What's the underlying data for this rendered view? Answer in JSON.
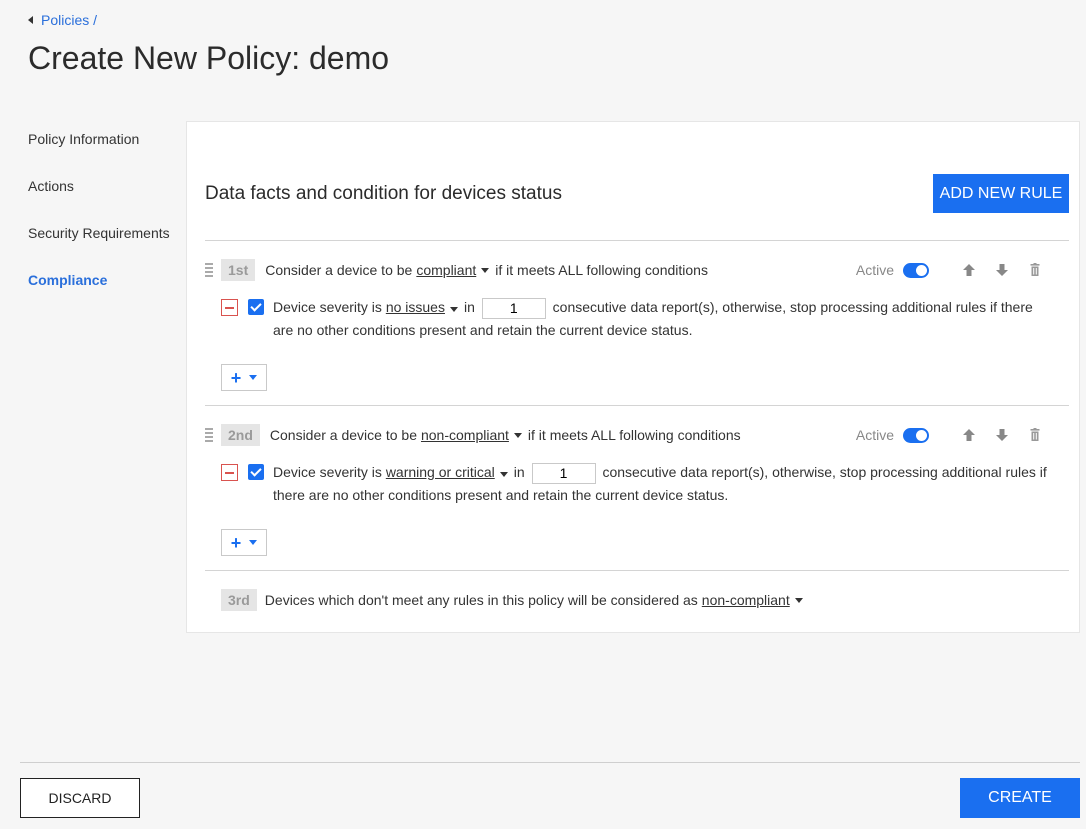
{
  "breadcrumb": {
    "label": "Policies /"
  },
  "page_title": "Create New Policy: demo",
  "sidebar": {
    "items": [
      {
        "label": "Policy Information",
        "active": false
      },
      {
        "label": "Actions",
        "active": false
      },
      {
        "label": "Security Requirements",
        "active": false
      },
      {
        "label": "Compliance",
        "active": true
      }
    ]
  },
  "panel": {
    "title": "Data facts and condition for devices status",
    "add_rule_label": "ADD NEW RULE",
    "rules": [
      {
        "rank": "1st",
        "prefix": "Consider a device to be",
        "status": "compliant",
        "suffix": "if it meets ALL following conditions",
        "active_label": "Active",
        "active": true,
        "condition": {
          "prefix": "Device severity is",
          "severity": "no issues",
          "in_label": "in",
          "count": "1",
          "rest": "consecutive data report(s), otherwise, stop processing additional rules if there are no other conditions present and retain the current device status."
        }
      },
      {
        "rank": "2nd",
        "prefix": "Consider a device to be",
        "status": "non-compliant",
        "suffix": "if it meets ALL following conditions",
        "active_label": "Active",
        "active": true,
        "condition": {
          "prefix": "Device severity is",
          "severity": "warning or critical",
          "in_label": "in",
          "count": "1",
          "rest": "consecutive data report(s), otherwise, stop processing additional rules if there are no other conditions present and retain the current device status."
        }
      }
    ],
    "default_rule": {
      "rank": "3rd",
      "prefix": "Devices which don't meet any rules in this policy will be considered as",
      "status": "non-compliant"
    }
  },
  "footer": {
    "discard_label": "DISCARD",
    "create_label": "CREATE"
  },
  "colors": {
    "accent": "#1a6ff0",
    "remove": "#d9534f"
  },
  "icons": [
    "chevron-left-icon",
    "drag-handle-icon",
    "toggle-switch",
    "arrow-up-icon",
    "arrow-down-icon",
    "trash-icon",
    "minus-icon",
    "checkbox-checked-icon",
    "plus-icon",
    "caret-down-icon"
  ]
}
